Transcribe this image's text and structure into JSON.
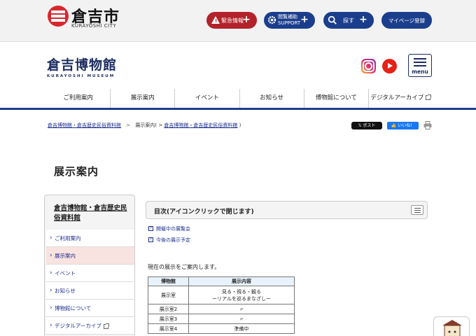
{
  "site": {
    "city_name": "倉吉市",
    "city_sub": "KURAYOSHI CITY",
    "buttons": {
      "emergency": "緊急情報",
      "access_line1": "閲覧補助",
      "access_line2": "SUPPORT",
      "search": "探す",
      "mypage": "マイページ登録"
    },
    "colors": {
      "brand_red": "#d7282f",
      "nav_blue": "#1b3e8c",
      "emergency_red": "#b2222a"
    }
  },
  "museum": {
    "name": "倉吉博物館",
    "sub": "KURAYOSHI MUSEUM",
    "menu_label": "menu"
  },
  "gnav": [
    {
      "label": "ご利用案内"
    },
    {
      "label": "展示案内"
    },
    {
      "label": "イベント"
    },
    {
      "label": "お知らせ"
    },
    {
      "label": "博物館について"
    },
    {
      "label": "デジタルアーカイブ"
    }
  ],
  "breadcrumb": {
    "home": "倉吉博物館・倉吉歴史民俗資料館",
    "current_prefix": "展示案内(",
    "current_link": "倉吉博物館・倉吉歴史民俗資料館",
    "current_suffix": ")"
  },
  "social": {
    "x_post": "ポスト",
    "fb_like": "いいね！"
  },
  "page_title": "展示案内",
  "sidebar": {
    "title": "倉吉博物館・倉吉歴史民俗資料館",
    "items": [
      {
        "label": "ご利用案内",
        "active": false
      },
      {
        "label": "展示案内",
        "active": true
      },
      {
        "label": "イベント",
        "active": false
      },
      {
        "label": "お知らせ",
        "active": false
      },
      {
        "label": "博物館について",
        "active": false
      },
      {
        "label": "デジタルアーカイブ",
        "active": false
      }
    ]
  },
  "toc": {
    "title": "目次(アイコンクリックで閉じます)",
    "links": [
      "開催中の展覧会",
      "今後の展示予定"
    ]
  },
  "intro": "現在の展示をご案内します。",
  "exhibit_table": {
    "headers": [
      "博物館",
      "展示内容"
    ],
    "rows": [
      {
        "room": "展示室",
        "content_line1": "見る・視る・観る",
        "content_line2": "ーリアルを巡るまなざしー"
      },
      {
        "room": "展示室2",
        "content_line1": "〃",
        "content_line2": ""
      },
      {
        "room": "展示室3",
        "content_line1": "〃",
        "content_line2": ""
      },
      {
        "room": "展示室4",
        "content_line1": "準備中",
        "content_line2": ""
      }
    ]
  }
}
